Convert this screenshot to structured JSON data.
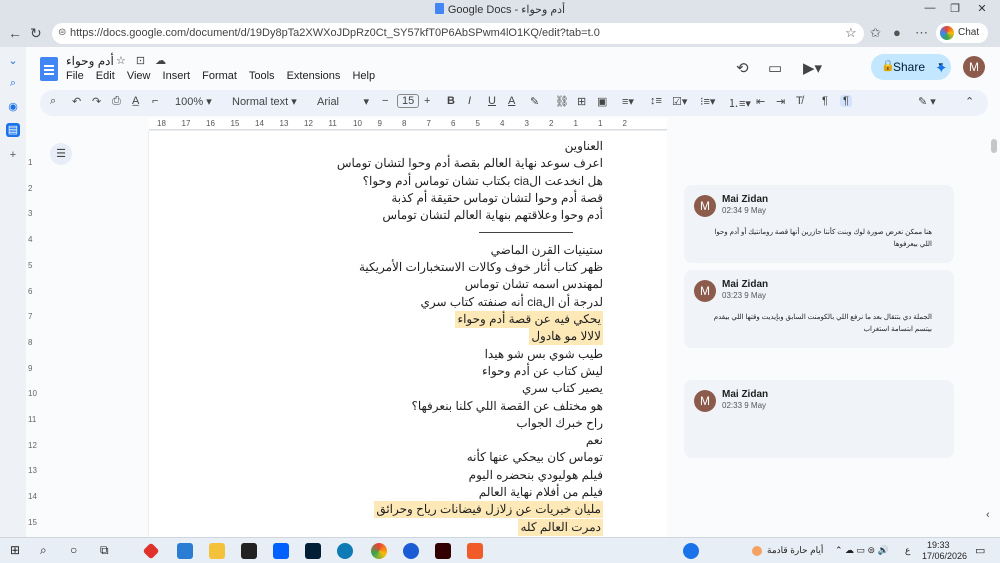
{
  "window": {
    "title": "Google Docs - أدم وحواء"
  },
  "browser": {
    "url": "https://docs.google.com/document/d/19Dy8pTa2XWXoJDpRz0Ct_SY57kfT0P6AbSPwm4lO1KQ/edit?tab=t.0",
    "chat_label": "Chat"
  },
  "doc": {
    "title": "أدم وحواء",
    "menu": [
      "File",
      "Edit",
      "View",
      "Insert",
      "Format",
      "Tools",
      "Extensions",
      "Help"
    ],
    "share_label": "Share",
    "avatar_letter": "M"
  },
  "toolbar": {
    "zoom": "100%",
    "style": "Normal text",
    "font": "Arial",
    "font_size": "15"
  },
  "ruler": {
    "h": [
      "18",
      "17",
      "16",
      "15",
      "14",
      "13",
      "12",
      "11",
      "10",
      "9",
      "8",
      "7",
      "6",
      "5",
      "4",
      "3",
      "2",
      "1",
      "1",
      "2"
    ],
    "v": [
      "1",
      "2",
      "3",
      "4",
      "5",
      "6",
      "7",
      "8",
      "9",
      "10",
      "11",
      "12",
      "13",
      "14",
      "15"
    ]
  },
  "lines": [
    {
      "text": "العناوين",
      "hl": false
    },
    {
      "text": "اعرف سوعد نهاية العالم بقصة أدم وحوا لتشان توماس",
      "hl": false
    },
    {
      "text": "هل انخدعت الcia بكتاب تشان توماس أدم وحوا؟",
      "hl": false
    },
    {
      "text": "قصة أدم وحوا لتشان توماس حقيقة أم كذبة",
      "hl": false
    },
    {
      "text": "أدم وحوا وعلاقتهم بنهاية العالم لتشان توماس",
      "hl": false
    },
    {
      "text": "",
      "hl": false
    },
    {
      "text": "ستينيات القرن الماضي",
      "hl": false
    },
    {
      "text": "ظهر كتاب أثار خوف وكالات الاستخبارات الأمريكية",
      "hl": false
    },
    {
      "text": "لمهندس اسمه تشان توماس",
      "hl": false
    },
    {
      "text": "لدرجة أن الcia أنه صنفته كتاب سري",
      "hl": false
    },
    {
      "text": "يحكي فيه عن قصة أدم وحواء",
      "hl": true
    },
    {
      "text": "لالالا مو هادول",
      "hl": true
    },
    {
      "text": "طيب شوي بس شو هيدا",
      "hl": false
    },
    {
      "text": "ليش كتاب عن أدم وحواء",
      "hl": false
    },
    {
      "text": "يصير كتاب سري",
      "hl": false
    },
    {
      "text": "هو مختلف عن القصة اللي كلنا بنعرفها؟",
      "hl": false
    },
    {
      "text": "راح خبرك الجواب",
      "hl": false
    },
    {
      "text": "نعم",
      "hl": false
    },
    {
      "text": "توماس كان بيحكي عنها كأنه",
      "hl": false
    },
    {
      "text": "فيلم هوليودي بنحضره اليوم",
      "hl": false
    },
    {
      "text": "فيلم من أفلام نهاية العالم",
      "hl": false
    },
    {
      "text": "مليان خبريات عن زلازل فيضانات رياح وحرائق",
      "hl": true
    },
    {
      "text": "دمرت العالم كله",
      "hl": true
    }
  ],
  "comments": [
    {
      "author": "Mai Zidan",
      "time": "02:34 9 May",
      "text": "هنا ممكن نعرض صورة لوك وبنت كأننا حازرين أنها قصة رومانتيك أو أدم وحوا اللي بيعرفوها"
    },
    {
      "author": "Mai Zidan",
      "time": "03:23 9 May",
      "text": "الجملة دي بتتقال بعد ما نرفع اللي بالكومنت السابق وبإيديت وقتها اللي بيقدم بيتسم ابتسامة استغراب"
    },
    {
      "author": "Mai Zidan",
      "time": "02:33 9 May",
      "text": ""
    }
  ],
  "taskbar": {
    "weather": "أيام حارة قادمة",
    "lang": "ع",
    "time": "19:33",
    "date": "17/06/2026"
  }
}
